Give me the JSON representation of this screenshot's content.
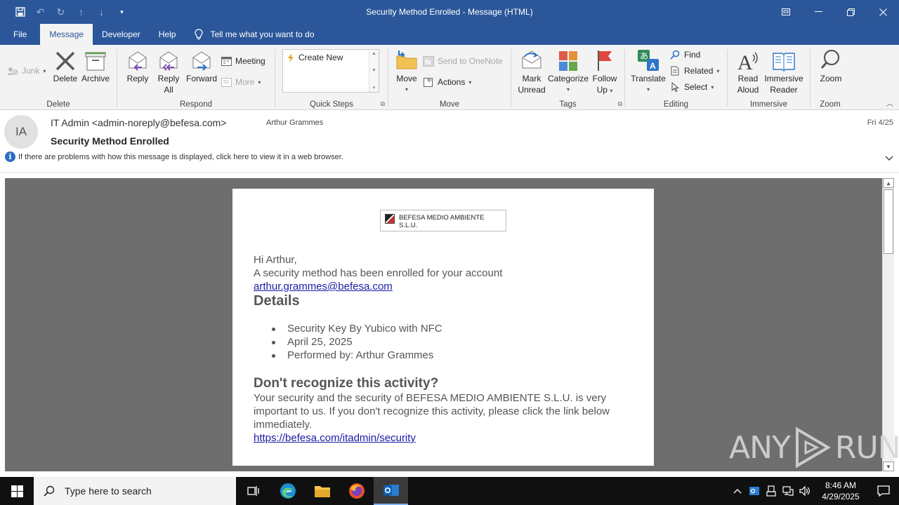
{
  "window": {
    "title": "Security Method Enrolled  -  Message (HTML)"
  },
  "menu": {
    "tabs": [
      "File",
      "Message",
      "Developer",
      "Help"
    ],
    "active_tab": "Message",
    "tell_me": "Tell me what you want to do"
  },
  "ribbon": {
    "delete_group": {
      "label": "Delete",
      "junk": "Junk",
      "delete": "Delete",
      "archive": "Archive"
    },
    "respond_group": {
      "label": "Respond",
      "reply": "Reply",
      "reply_all_1": "Reply",
      "reply_all_2": "All",
      "forward": "Forward",
      "meeting": "Meeting",
      "more": "More"
    },
    "quick_steps_group": {
      "label": "Quick Steps",
      "create_new": "Create New"
    },
    "move_group": {
      "label": "Move",
      "move": "Move",
      "send_onenote": "Send to OneNote",
      "actions": "Actions"
    },
    "tags_group": {
      "label": "Tags",
      "mark_unread_1": "Mark",
      "mark_unread_2": "Unread",
      "categorize": "Categorize",
      "follow_up_1": "Follow",
      "follow_up_2": "Up"
    },
    "editing_group": {
      "label": "Editing",
      "translate": "Translate",
      "find": "Find",
      "related": "Related",
      "select": "Select"
    },
    "immersive_group": {
      "label": "Immersive",
      "read_aloud_1": "Read",
      "read_aloud_2": "Aloud",
      "immersive_reader_1": "Immersive",
      "immersive_reader_2": "Reader"
    },
    "zoom_group": {
      "label": "Zoom",
      "zoom": "Zoom"
    }
  },
  "message": {
    "avatar_initials": "IA",
    "sender": "IT Admin <admin-noreply@befesa.com>",
    "recipient": "Arthur Grammes",
    "date": "Fri 4/25",
    "subject": "Security Method Enrolled",
    "info_bar": "If there are problems with how this message is displayed, click here to view it in a web browser."
  },
  "email_body": {
    "logo_alt": "BEFESA MEDIO AMBIENTE S.L.U.",
    "greeting": "Hi Arthur,",
    "intro": "A security method has been enrolled for your account",
    "account_link": "arthur.grammes@befesa.com",
    "details_heading": "Details",
    "details": [
      "Security Key By Yubico with NFC",
      "April 25, 2025",
      "Performed by:  Arthur Grammes"
    ],
    "dont_recognize_heading": "Don't recognize this activity?",
    "paragraph": "Your security and the security of BEFESA MEDIO AMBIENTE S.L.U. is very important to us. If you don't recognize this activity, please click the link below immediately.",
    "security_link": "https://befesa.com/itadmin/security"
  },
  "watermark": {
    "text_left": "ANY",
    "text_right": "RUN"
  },
  "taskbar": {
    "search_placeholder": "Type here to search",
    "time": "8:46 AM",
    "date": "4/29/2025"
  },
  "colors": {
    "title_bar": "#2b579a",
    "ribbon_bg": "#f3f3f3",
    "reading_bg": "#6e6e6e",
    "link": "#1a1aa6",
    "taskbar": "#101010"
  }
}
